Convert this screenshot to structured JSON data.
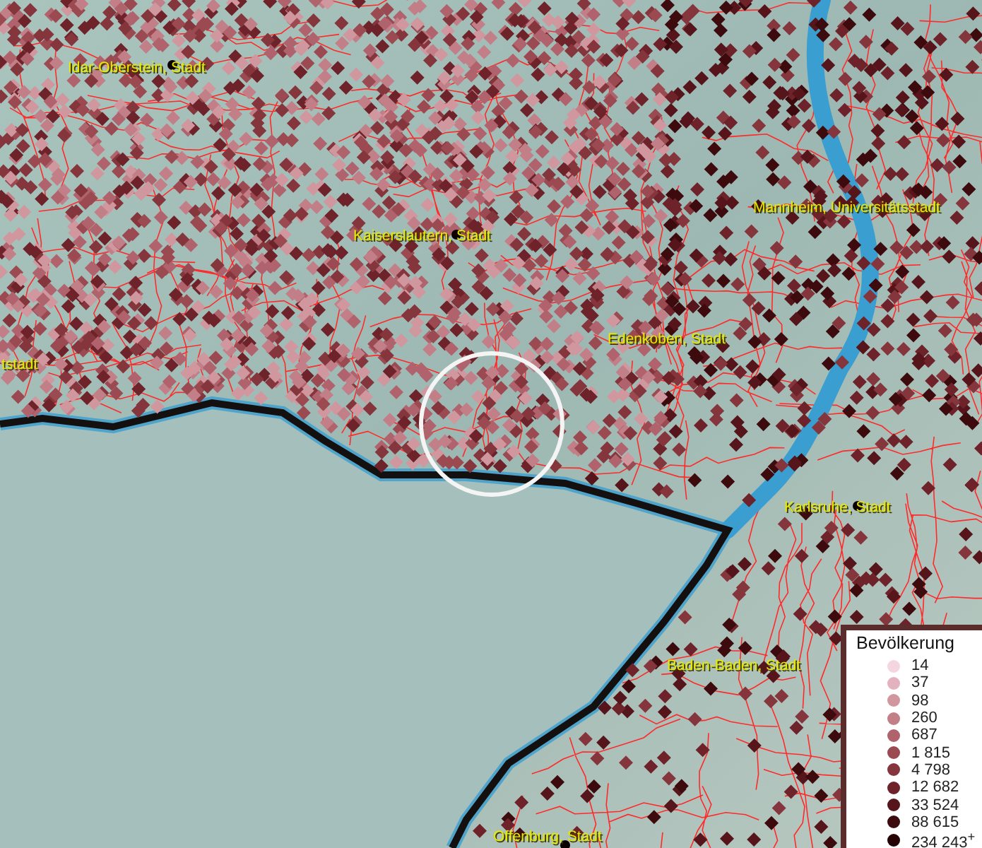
{
  "map": {
    "place_labels": [
      {
        "text": "Idar-Oberstein, Stadt"
      },
      {
        "text": "Kaiserslautern, Stadt"
      },
      {
        "text": "Mannheim, Universitätsstadt"
      },
      {
        "text": "tstadt"
      },
      {
        "text": "Edenkoben, Stadt"
      },
      {
        "text": "Karlsruhe, Stadt"
      },
      {
        "text": "Baden-Baden, Stadt"
      },
      {
        "text": "Offenburg, Stadt"
      }
    ]
  },
  "legend": {
    "title": "Bevölkerung",
    "items": [
      {
        "label": "14",
        "color": "#f5d6e0"
      },
      {
        "label": "37",
        "color": "#e3b2be"
      },
      {
        "label": "98",
        "color": "#d1979f"
      },
      {
        "label": "260",
        "color": "#c27f88"
      },
      {
        "label": "687",
        "color": "#b0636c"
      },
      {
        "label": "1 815",
        "color": "#9b4a52"
      },
      {
        "label": "4 798",
        "color": "#85353c"
      },
      {
        "label": "12 682",
        "color": "#6e2229"
      },
      {
        "label": "33 524",
        "color": "#55151a"
      },
      {
        "label": "88 615",
        "color": "#3d0a0e"
      },
      {
        "label": "234 243$^{+}$",
        "color": "#250406"
      }
    ]
  }
}
